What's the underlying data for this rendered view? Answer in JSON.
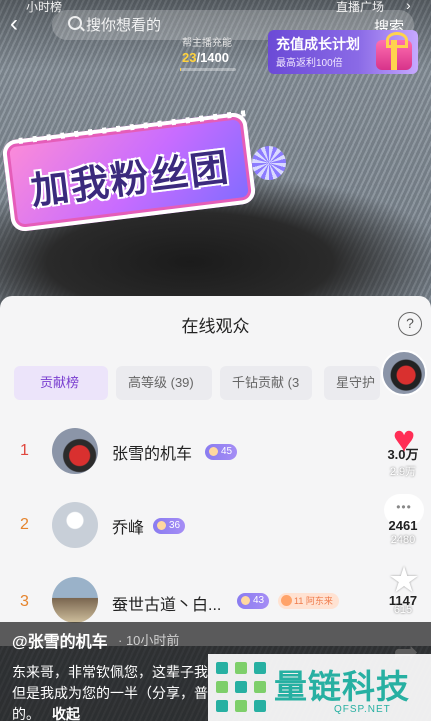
{
  "top_bar": {
    "left_tag": "小时榜",
    "right_tag": "直播广场",
    "search_placeholder": "搜你想看的",
    "search_button": "搜索"
  },
  "energy": {
    "label": "帮主播充能",
    "current": "23",
    "total": "/1400",
    "progress": 0.016
  },
  "promo": {
    "title": "充值成长计划",
    "subtitle": "最高返利100倍"
  },
  "fan_sign": {
    "text": "加我粉丝团"
  },
  "sheet": {
    "title": "在线观众",
    "help": "?",
    "tabs": [
      {
        "label": "贡献榜"
      },
      {
        "label": "高等级 (39)"
      },
      {
        "label": "千钻贡献 (3"
      },
      {
        "label": "星守护"
      }
    ],
    "ranking": [
      {
        "rank": "1",
        "name": "张雪的机车",
        "level": "45",
        "fan_badge": ""
      },
      {
        "rank": "2",
        "name": "乔峰",
        "level": "36",
        "fan_badge": ""
      },
      {
        "rank": "3",
        "name": "蚕世古道丶白...",
        "level": "43",
        "fan_badge": "11 阿东来"
      }
    ]
  },
  "actions": {
    "rank1_score": "3.0万",
    "likes": "2.9万",
    "rank2_score": "2461",
    "comments": "2480",
    "rank3_score": "1147",
    "favorites": "615"
  },
  "caption": {
    "author": "@张雪的机车",
    "time": "· 10小时前",
    "line1": "东来哥，非常钦佩您，这辈子我",
    "line2": "但是我成为您的一半（分享，普",
    "line3": "的。",
    "collapse": "收起"
  },
  "watermark": {
    "text": "量链科技",
    "sub": "QFSP.NET"
  },
  "colors": {
    "accent_purple": "#7a3fd0",
    "rank_first": "#e0473e",
    "rank_other": "#e5842d",
    "heart": "#ff2d55",
    "watermark": "#27b0a2"
  }
}
